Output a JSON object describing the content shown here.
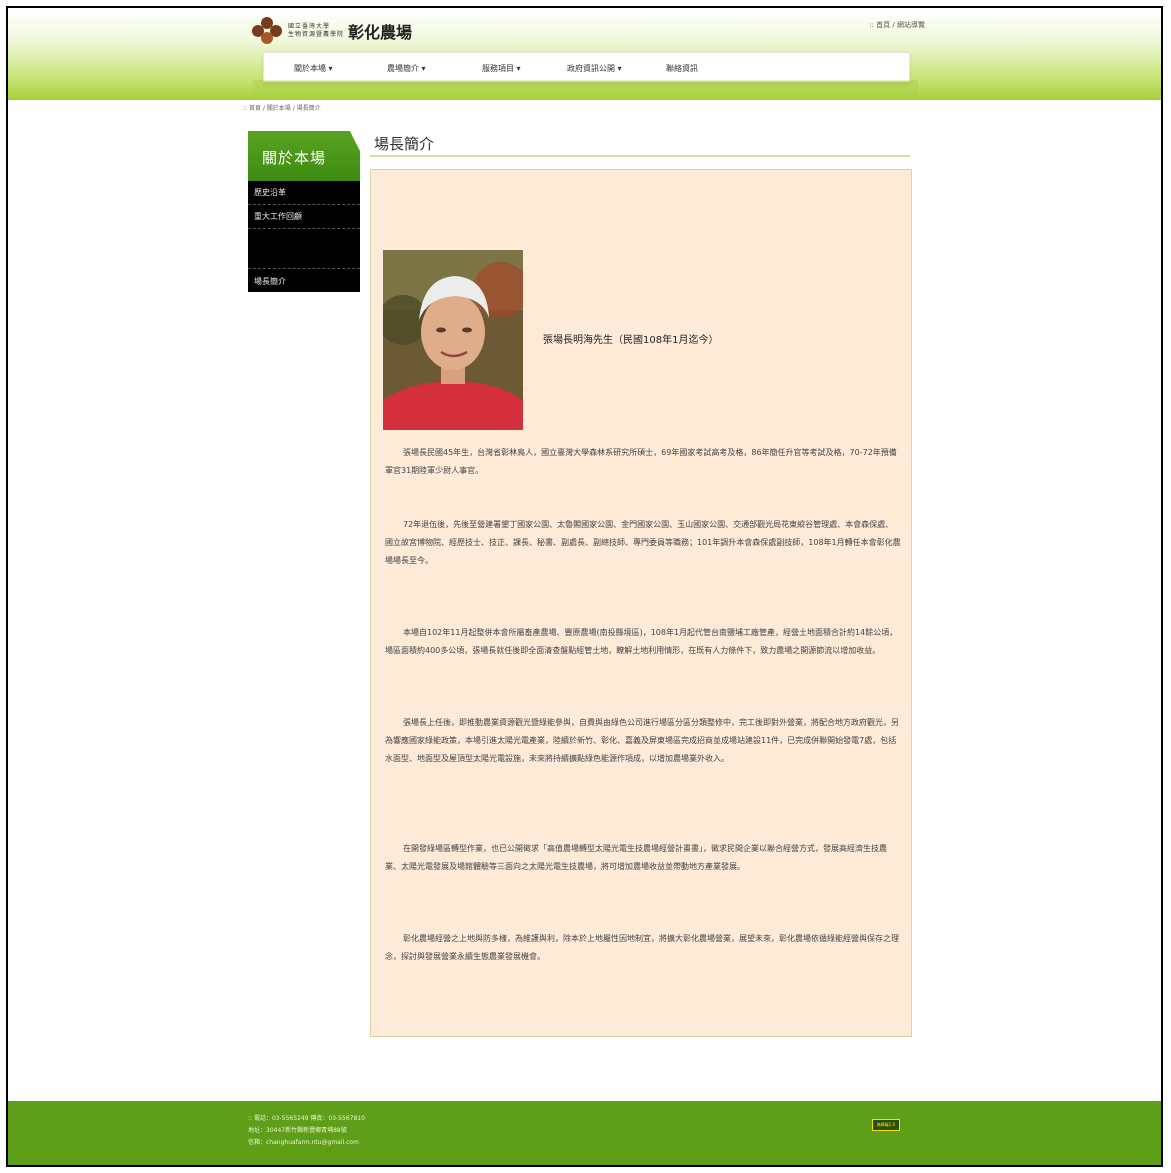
{
  "header": {
    "logo_small_line1": "國立臺灣大學",
    "logo_small_line2": "生物資源暨農學院",
    "logo_name": "彰化農場",
    "top_links": ":: 首頁 / 網站導覽"
  },
  "nav": {
    "items": [
      {
        "label": "關於本場 ▾"
      },
      {
        "label": "農場簡介 ▾"
      },
      {
        "label": "服務項目 ▾"
      },
      {
        "label": "政府資訊公開 ▾"
      },
      {
        "label": "聯絡資訊"
      }
    ]
  },
  "breadcrumb": ":: 首頁 / 關於本場 / 場長簡介",
  "sidebar": {
    "title": "關於本場",
    "items": [
      {
        "label": "歷史沿革"
      },
      {
        "label": "重大工作回顧"
      },
      {
        "label": ""
      },
      {
        "label": "場長簡介"
      }
    ]
  },
  "main": {
    "title": "場長簡介",
    "caption": "張場長明海先生（民國108年1月迄今）",
    "paragraphs": [
      "張場長民國45年生，台灣省彰林鳥人，國立臺灣大學森林系研究所碩士，69年國家考試高考及格，86年簡任升官等考試及格，70-72年預備軍官31期陸軍少尉人事官。",
      "72年退伍後，先後至營建署墾丁國家公園、太魯閣國家公園、金門國家公園、玉山國家公園、交通部觀光局花東縱谷管理處、本會森保處、國立故宮博物院、經歷技士、技正、課長、秘書、副處長、副總技師、專門委員等職務；101年調升本會森保處副技師，108年1月轉任本會彰化農場場長至今。",
      "本場自102年11月起整併本會所屬畜產農場、豐原農場(南投縣境區)，108年1月起代管台南鹽埔工廠管產，經營土地面積合計約14餘公頃，場區面積約400多公頃，張場長就任後即全面清查盤點經管土地，瞭解土地利用情形，在既有人力條件下，致力農場之開源節流以增加收益。",
      "張場長上任後，即推動農業資源觀光暨綠能參與，自費與由綠色公司進行場區分區分類整修中，完工後即對外營業，將配合地方政府觀光，另為響應國家綠能政策，本場引進太陽光電產業，陸續於新竹、彰化、嘉義及屏東場區完成招商並成場站建設11件，已完成併聯開始發電7處，包括水面型、地面型及屋頂型太陽光電設施，未來將持續擴點綠色能源作項成，以增加農場業外收入。",
      "在開發綠場區轉型作業，也已公開徵求「高值農場轉型太陽光電生技農場經營計畫書」，徵求民間企業以聯合經營方式，發展高經濟生技農業、太陽光電發展及場館體驗等三面向之太陽光電生技農場，將可增加農場收益並帶動地方產業發展。",
      "彰化農場經營之上地與防多樣，為維護與利，除本於上地屬性因地制宜，將擴大彰化農場營業，展望未來，彰化農場依循綠能經營與保存之理念，探討與發展營業永續生態農業發展機會。"
    ]
  },
  "footer": {
    "line1": ":: 電話：03-5565249  傳真：03-5567810",
    "line2": "地址：30447新竹縣新豐鄉青埔88號",
    "line3": "信箱：changhuafarm.ntu@gmail.com",
    "badge": "無障礙2.0"
  },
  "colors": {
    "accent_green": "#5e9e18",
    "content_bg": "#fdebd8"
  }
}
